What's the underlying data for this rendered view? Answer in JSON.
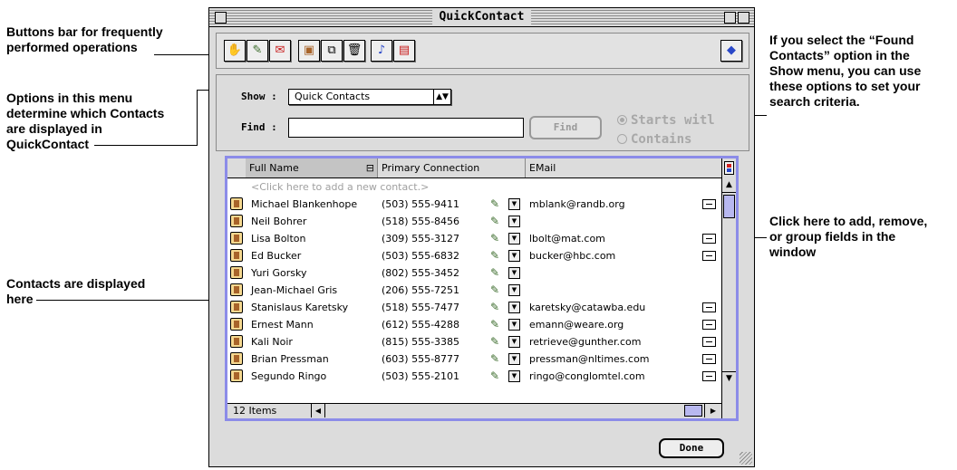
{
  "window": {
    "title": "QuickContact"
  },
  "callouts": {
    "buttons_bar": [
      "Buttons bar for frequently",
      "performed operations"
    ],
    "options_menu": [
      "Options in this menu",
      "determine which Contacts",
      "are displayed in",
      "QuickContact"
    ],
    "contacts_displayed": [
      "Contacts are displayed",
      "here"
    ],
    "search_criteria": [
      "If you select the “Found",
      "Contacts” option in the",
      "Show menu, you can use",
      "these options to set your",
      "search criteria."
    ],
    "fields": [
      "Click here to add, remove,",
      "or group fields in the",
      "window"
    ]
  },
  "toolbar": {
    "icons": [
      "handshake-icon",
      "dial-phone-icon",
      "mail-check-icon",
      "contact-card-icon",
      "duplicate-icon",
      "trash-icon",
      "note-icon",
      "chart-icon",
      "help-icon"
    ]
  },
  "search": {
    "show_label": "Show :",
    "show_value": "Quick Contacts",
    "find_label": "Find :",
    "find_value": "",
    "find_button": "Find",
    "option_starts": "Starts witl",
    "option_contains": "Contains"
  },
  "list": {
    "columns": [
      "Full Name",
      "Primary Connection",
      "EMail"
    ],
    "add_prompt": "<Click here to add a new contact.>",
    "rows": [
      {
        "name": "Michael Blankenhope",
        "phone": "(503) 555-9411",
        "email": "mblank@randb.org"
      },
      {
        "name": "Neil Bohrer",
        "phone": "(518) 555-8456",
        "email": ""
      },
      {
        "name": "Lisa Bolton",
        "phone": "(309) 555-3127",
        "email": "lbolt@mat.com"
      },
      {
        "name": "Ed Bucker",
        "phone": "(503) 555-6832",
        "email": "bucker@hbc.com"
      },
      {
        "name": "Yuri Gorsky",
        "phone": "(802) 555-3452",
        "email": ""
      },
      {
        "name": "Jean-Michael Gris",
        "phone": "(206) 555-7251",
        "email": ""
      },
      {
        "name": "Stanislaus Karetsky",
        "phone": "(518) 555-7477",
        "email": "karetsky@catawba.edu"
      },
      {
        "name": "Ernest Mann",
        "phone": "(612) 555-4288",
        "email": "emann@weare.org"
      },
      {
        "name": "Kali Noir",
        "phone": "(815) 555-3385",
        "email": "retrieve@gunther.com"
      },
      {
        "name": "Brian Pressman",
        "phone": "(603) 555-8777",
        "email": "pressman@nltimes.com"
      },
      {
        "name": "Segundo Ringo",
        "phone": "(503) 555-2101",
        "email": "ringo@conglomtel.com"
      }
    ],
    "item_count": "12 Items"
  },
  "done_button": "Done"
}
